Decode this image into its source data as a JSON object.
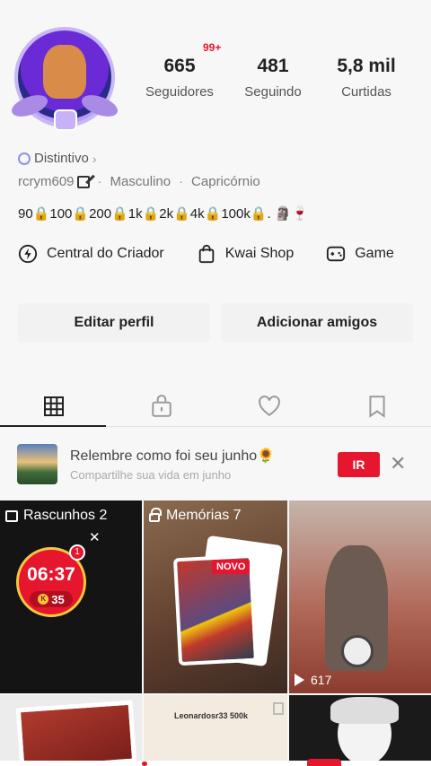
{
  "profile": {
    "notif_badge": "99+",
    "stats": [
      {
        "value": "665",
        "label": "Seguidores"
      },
      {
        "value": "481",
        "label": "Seguindo"
      },
      {
        "value": "5,8 mil",
        "label": "Curtidas"
      }
    ],
    "distintivo_label": "Distintivo",
    "username": "rcrym609",
    "gender": "Masculino",
    "sign": "Capricórnio",
    "bio": "90🔒100🔒200🔒1k🔒2k🔒4k🔒100k🔒. 🗿🍷"
  },
  "shortcuts": [
    {
      "label": "Central do Criador",
      "icon": "lightning-icon"
    },
    {
      "label": "Kwai Shop",
      "icon": "shopping-bag-icon"
    },
    {
      "label": "Game",
      "icon": "gamepad-icon"
    }
  ],
  "actions": {
    "edit_label": "Editar perfil",
    "add_label": "Adicionar amigos"
  },
  "tabs": [
    {
      "name": "grid-icon",
      "active": true
    },
    {
      "name": "lock-bag-icon",
      "active": false
    },
    {
      "name": "heart-icon",
      "active": false
    },
    {
      "name": "bookmark-icon",
      "active": false
    }
  ],
  "banner": {
    "title": "Relembre como foi seu junho🌻",
    "subtitle": "Compartilhe sua vida em junho",
    "cta": "IR"
  },
  "grid": {
    "drafts_label": "Rascunhos 2",
    "timer": "06:37",
    "timer_dot": "1",
    "coins": "35",
    "coin_letter": "K",
    "memories_label": "Memórias 7",
    "new_badge": "NOVO",
    "plays": "617",
    "strip_text": "Leonardosr33 500k"
  },
  "colors": {
    "accent": "#e5162e",
    "background": "#f7f7f7"
  }
}
